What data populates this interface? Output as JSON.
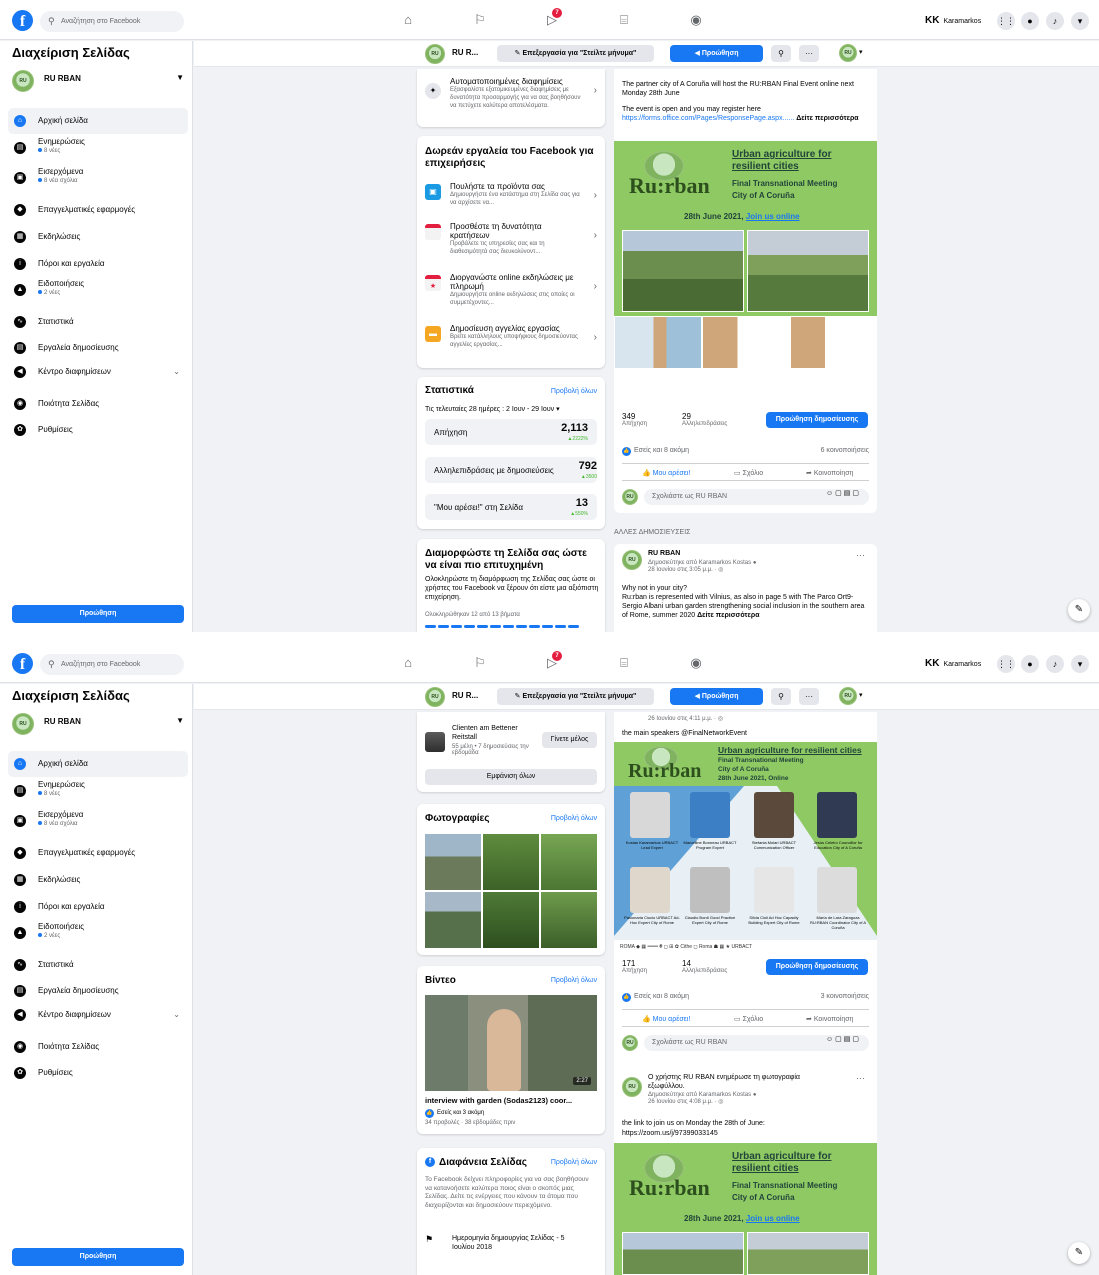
{
  "colors": {
    "brand": "#1877f2",
    "page_bg": "#f0f2f5",
    "banner_green": "#8fc964",
    "growth": "#42b72a"
  },
  "topbar": {
    "search_placeholder": "Αναζήτηση στο Facebook",
    "notif_badge": "7",
    "user_initials": "KK",
    "user_name": "Karamarkos"
  },
  "left": {
    "title": "Διαχείριση Σελίδας",
    "page_name": "RU RBAN",
    "logo_text": "RU:RBAN",
    "items": [
      {
        "label": "Αρχική σελίδα",
        "icon": "home-icon",
        "sub": ""
      },
      {
        "label": "Ενημερώσεις",
        "icon": "news-icon",
        "sub": "8 νέες"
      },
      {
        "label": "Εισερχόμενα",
        "icon": "inbox-icon",
        "sub": "8 νέα σχόλια"
      },
      {
        "label": "Επαγγελματικές εφαρμογές",
        "icon": "apps-icon",
        "sub": ""
      },
      {
        "label": "Εκδηλώσεις",
        "icon": "calendar-icon",
        "sub": ""
      },
      {
        "label": "Πόροι και εργαλεία",
        "icon": "info-icon",
        "sub": ""
      },
      {
        "label": "Ειδοποιήσεις",
        "icon": "bell-icon",
        "sub": "2 νέες"
      },
      {
        "label": "Στατιστικά",
        "icon": "chart-icon",
        "sub": ""
      },
      {
        "label": "Εργαλεία δημοσίευσης",
        "icon": "publish-icon",
        "sub": ""
      },
      {
        "label": "Κέντρο διαφημίσεων",
        "icon": "megaphone-icon",
        "sub": ""
      },
      {
        "label": "Ποιότητα Σελίδας",
        "icon": "quality-icon",
        "sub": ""
      },
      {
        "label": "Ρυθμίσεις",
        "icon": "gear-icon",
        "sub": ""
      }
    ],
    "promote": "Προώθηση"
  },
  "subbar": {
    "name": "RU R...",
    "edit": "Επεξεργασία για \"Στείλτε μήνυμα\"",
    "promote": "Προώθηση"
  },
  "shot1": {
    "auto": {
      "title": "Αυτοματοποιημένες διαφημίσεις",
      "desc": "Εξασφαλίστε εξατομικευμένες διαφημίσεις με δυνατότητα προσαρμογής για να σας βοηθήσουν να πετύχετε καλύτερα αποτελέσματα."
    },
    "tools_title": "Δωρεάν εργαλεία του Facebook για επιχειρήσεις",
    "tools": [
      {
        "title": "Πουλήστε τα προϊόντα σας",
        "desc": "Δημιουργήστε ένα κατάστημα στη Σελίδα σας για να αρχίσετε να..."
      },
      {
        "title": "Προσθέστε τη δυνατότητα κρατήσεων",
        "desc": "Προβάλετε τις υπηρεσίες σας και τη διαθεσιμότητά σας διευκολύνοντ..."
      },
      {
        "title": "Διοργανώστε online εκδηλώσεις με πληρωμή",
        "desc": "Δημιουργήστε online εκδηλώσεις στις οποίες οι συμμετέχοντες..."
      },
      {
        "title": "Δημοσίευση αγγελίας εργασίας",
        "desc": "Βρείτε κατάλληλους υποψήφιους δημοσιεύοντας αγγελίες εργασίας..."
      }
    ],
    "stats": {
      "title": "Στατιστικά",
      "see_all": "Προβολή όλων",
      "range": "Τις τελευταίες 28 ημέρες : 2 Ιουν - 29 Ιουν ▾",
      "rows": [
        {
          "label": "Απήχηση",
          "value": "2,113",
          "delta": "▲2222%"
        },
        {
          "label": "Αλληλεπιδράσεις με δημοσιεύσεις",
          "value": "792",
          "delta": "▲3500"
        },
        {
          "label": "\"Μου αρέσει!\" στη Σελίδα",
          "value": "13",
          "delta": "▲550%"
        }
      ]
    },
    "setup": {
      "title": "Διαμορφώστε τη Σελίδα σας ώστε να είναι πιο επιτυχημένη",
      "desc": "Ολοκληρώστε τη διαμόρφωση της Σελίδας σας ώστε οι χρήστες του Facebook να ξέρουν ότι είστε μια αξιόπιστη επιχείρηση.",
      "progress": "Ολοκληρώθηκαν 12 από 13 βήματα"
    },
    "post": {
      "text1": "The partner city of A Coruña will host the RU:RBAN Final Event online next Monday 28th June",
      "text2": "The event is open and you may register here",
      "url": "https://forms.office.com/Pages/ResponsePage.aspx......",
      "more": "Δείτε περισσότερα",
      "banner": {
        "ruban": "Ru:rban",
        "title": "Urban agriculture for resilient cities",
        "sub1": "Final Transnational Meeting",
        "sub2": "City of A Coruña",
        "date": "28th June 2021,",
        "join": "Join us online"
      },
      "reach": "349",
      "reach_label": "Απήχηση",
      "eng": "29",
      "eng_label": "Αλληλεπιδράσεις",
      "boost": "Προώθηση δημοσίευσης",
      "reactions": "Εσείς και 8 ακόμη",
      "shares": "6 κοινοποιήσεις",
      "like": "Μου αρέσει!",
      "comment": "Σχόλιο",
      "share": "Κοινοποίηση",
      "comment_as": "Σχολιάστε ως RU RBAN"
    },
    "other_posts": "ΑΛΛΕΣ ΔΗΜΟΣΙΕΥΣΕΙΣ",
    "post2": {
      "name": "RU RBAN",
      "meta1": "Δημοσιεύτηκε από Karamarkos Kostas ●",
      "meta2": "28 Ιουνίου στις 3:05 μ.μ. · ◎",
      "text": "Why not in your city?\nRu:rban is represented with Vilnius, as also in page 5 with The Parco Ort9-Sergio Albani urban garden strengthening social inclusion in the southern area of Rome, summer 2020",
      "more": "Δείτε περισσότερα"
    }
  },
  "shot2": {
    "group": {
      "name": "Clienten am Bettener Reitstall",
      "meta": "55 μέλη • 7 δημοσιεύσεις την εβδομάδα",
      "join": "Γίνετε μέλος",
      "show_all": "Εμφάνιση όλων"
    },
    "photos": {
      "title": "Φωτογραφίες",
      "see_all": "Προβολή όλων"
    },
    "videos": {
      "title": "Βίντεο",
      "see_all": "Προβολή όλων",
      "duration": "2:27",
      "caption": "interview with garden (Sodas2123) coor...",
      "reactions": "Εσείς και 3 ακόμη",
      "meta": "34 προβολές · 38 εβδομάδες πριν"
    },
    "transparency": {
      "title": "Διαφάνεια Σελίδας",
      "see_all": "Προβολή όλων",
      "desc": "Το Facebook δείχνει πληροφορίες για να σας βοηθήσουν να κατανοήσετε καλύτερα ποιος είναι ο σκοπός μιας Σελίδας. Δείτε τις ενέργειες που κάνουν τα άτομα που διαχειρίζονται και δημοσιεύουν περιεχόμενο.",
      "date": "Ημερομηνία δημιουργίας Σελίδας - 5 Ιουλίου 2018"
    },
    "post": {
      "time": "26 Ιουνίου στις 4:11 μ.μ. · ◎",
      "text": "the main speakers @FinalNetworkEvent",
      "banner": {
        "ruban": "Ru:rban",
        "title": "Urban agriculture for resilient cities",
        "sub1": "Final Transnational Meeting",
        "sub2": "City of A Coruña",
        "sub3": "28th June 2021, Online",
        "speakers": [
          "Kostas Karamarkos URBACT Lead Expert",
          "Marcelline Bonneau URBACT Program Expert",
          "Stefania Molari URBACT Communication Officer",
          "Jesús Celeiro Councillor for Education City of A Coruña",
          "Pasionaria Ciucio URBACT Ad-Hoc Expert City of Rome",
          "Claudio Bordi Good Practice Expert City of Rome",
          "Silvia Cioli Ad Hoc Capacity Building Expert City of Rome",
          "María de Lara Zaragoza RU:RBAN Coordinator City of A Coruña"
        ],
        "logos": "ROMA ◆ ▦ ═══ ₴ ◻ ⊞ ✿ Cithe ◻ Roma ☗ ▦ ★ URBACT"
      },
      "reach": "171",
      "reach_label": "Απήχηση",
      "eng": "14",
      "eng_label": "Αλληλεπιδράσεις",
      "boost": "Προώθηση δημοσίευσης",
      "reactions": "Εσείς και 8 ακόμη",
      "shares": "3 κοινοποιήσεις",
      "like": "Μου αρέσει!",
      "comment": "Σχόλιο",
      "share": "Κοινοποίηση",
      "comment_as": "Σχολιάστε ως RU RBAN"
    },
    "post2": {
      "head": "Ο χρήστης RU RBAN ενημέρωσε τη φωτογραφία εξωφύλλου.",
      "meta1": "Δημοσιεύτηκε από Karamarkos Kostas ●",
      "meta2": "26 Ιουνίου στις 4:08 μ.μ. · ◎",
      "text": "the link to join us on Monday the 28th of June:",
      "url": "https://zoom.us/j/97399033145",
      "banner": {
        "ruban": "Ru:rban",
        "title": "Urban agriculture for resilient cities",
        "sub1": "Final Transnational Meeting",
        "sub2": "City of A Coruña",
        "date": "28th June 2021,",
        "join": "Join us online"
      }
    }
  }
}
